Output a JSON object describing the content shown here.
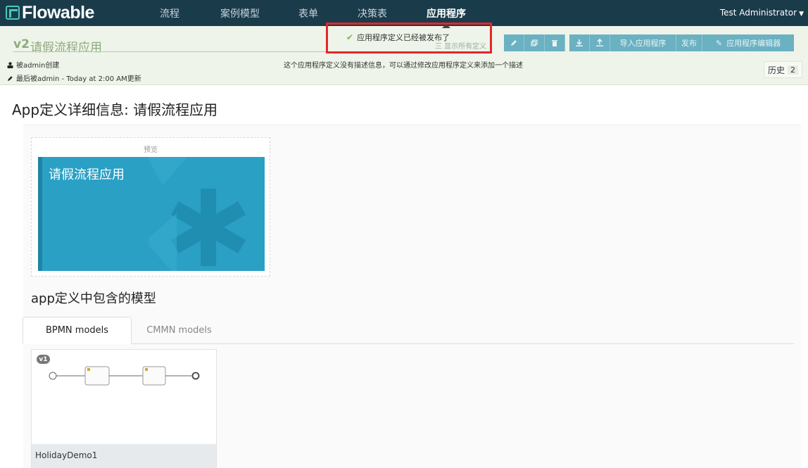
{
  "nav": {
    "logo": "Flowable",
    "items": [
      "流程",
      "案例模型",
      "表单",
      "决策表",
      "应用程序"
    ],
    "active_index": 4,
    "user": "Test Administrator"
  },
  "header": {
    "version": "v2",
    "title": "请假流程应用",
    "show_all": "三 显示所有定义",
    "created": "被admin创建",
    "updated": "最后被admin - Today at 2:00 AM更新",
    "description": "这个应用程序定义没有描述信息，可以通过修改应用程序定义来添加一个描述",
    "history_label": "历史",
    "history_count": "2"
  },
  "toolbar": {
    "import_label": "导入应用程序",
    "publish_label": "发布",
    "editor_label": "应用程序编辑器",
    "editor_icon": "✎"
  },
  "notification": {
    "text": "应用程序定义已经被发布了"
  },
  "main": {
    "heading": "App定义详细信息: 请假流程应用",
    "preview_label": "预览",
    "tile_title": "请假流程应用",
    "tile_color": "#2aa0c4",
    "models_heading": "app定义中包含的模型",
    "tabs": [
      "BPMN models",
      "CMMN models"
    ],
    "model": {
      "version": "v1",
      "name": "HolidayDemo1"
    }
  },
  "colors": {
    "navbar": "#1a3b4a",
    "accent": "#3f9bb5",
    "highlight": "#e52629"
  }
}
